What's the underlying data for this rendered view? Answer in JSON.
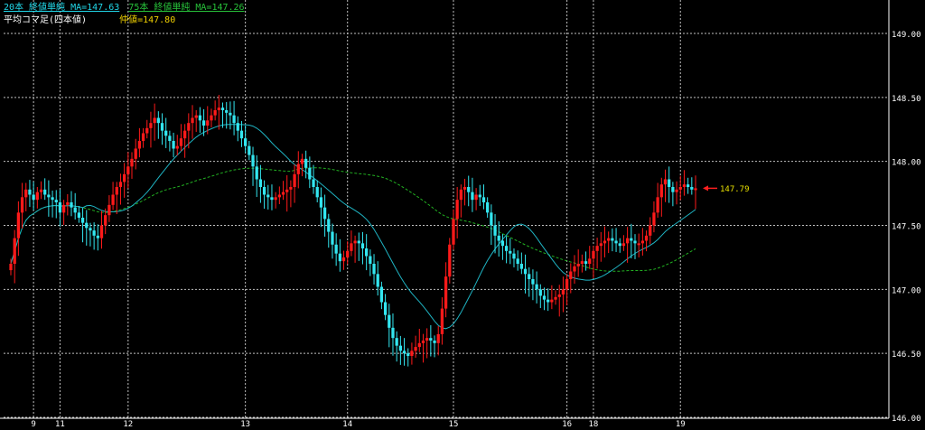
{
  "legend": {
    "ma20": "20本 終値単純 MA=147.63",
    "ma75": "75本 終値単純 MA=147.26",
    "candle_type": "平均コマ足(四本値)",
    "mid_price": "仲値=147.80"
  },
  "current_price_label": "147.79",
  "colors": {
    "background": "#000000",
    "grid": "#bfbfbf",
    "up": "#ff1a1a",
    "down": "#33e6f0",
    "ma20": "#1fb3c2",
    "ma75": "#22b022",
    "price_label": "#e8e000",
    "arrow": "#ff2020"
  },
  "chart_data": {
    "type": "candlestick",
    "y_ticks": [
      "149.00",
      "148.50",
      "148.00",
      "147.50",
      "147.00",
      "146.50",
      "146.00"
    ],
    "ylim": [
      146.0,
      149.2
    ],
    "x_ticks": [
      {
        "label": "9",
        "i": 6
      },
      {
        "label": "11",
        "i": 13
      },
      {
        "label": "12",
        "i": 31
      },
      {
        "label": "13",
        "i": 62
      },
      {
        "label": "14",
        "i": 89
      },
      {
        "label": "15",
        "i": 117
      },
      {
        "label": "16",
        "i": 147
      },
      {
        "label": "18",
        "i": 154
      },
      {
        "label": "19",
        "i": 177
      }
    ],
    "close": [
      147.2,
      147.4,
      147.6,
      147.72,
      147.78,
      147.74,
      147.7,
      147.76,
      147.78,
      147.74,
      147.72,
      147.7,
      147.68,
      147.6,
      147.66,
      147.68,
      147.64,
      147.6,
      147.56,
      147.52,
      147.48,
      147.46,
      147.42,
      147.4,
      147.5,
      147.58,
      147.66,
      147.74,
      147.8,
      147.84,
      147.9,
      147.96,
      148.02,
      148.1,
      148.16,
      148.22,
      148.26,
      148.3,
      148.34,
      148.3,
      148.24,
      148.2,
      148.16,
      148.1,
      148.12,
      148.18,
      148.24,
      148.3,
      148.34,
      148.36,
      148.32,
      148.28,
      148.32,
      148.36,
      148.4,
      148.42,
      148.4,
      148.38,
      148.36,
      148.3,
      148.24,
      148.18,
      148.12,
      148.05,
      147.96,
      147.86,
      147.8,
      147.74,
      147.72,
      147.7,
      147.72,
      147.74,
      147.76,
      147.78,
      147.8,
      147.9,
      147.98,
      148.02,
      147.95,
      147.86,
      147.8,
      147.72,
      147.64,
      147.55,
      147.45,
      147.35,
      147.28,
      147.22,
      147.25,
      147.3,
      147.36,
      147.38,
      147.36,
      147.32,
      147.26,
      147.2,
      147.12,
      147.02,
      146.9,
      146.8,
      146.7,
      146.62,
      146.56,
      146.52,
      146.5,
      146.48,
      146.52,
      146.55,
      146.58,
      146.6,
      146.62,
      146.6,
      146.58,
      146.65,
      146.85,
      147.1,
      147.35,
      147.55,
      147.7,
      147.78,
      147.8,
      147.76,
      147.7,
      147.74,
      147.72,
      147.68,
      147.6,
      147.5,
      147.42,
      147.38,
      147.34,
      147.3,
      147.28,
      147.24,
      147.2,
      147.16,
      147.12,
      147.08,
      147.04,
      147.0,
      146.95,
      146.92,
      146.9,
      146.92,
      146.94,
      146.96,
      147.0,
      147.08,
      147.14,
      147.18,
      147.2,
      147.22,
      147.2,
      147.24,
      147.3,
      147.34,
      147.36,
      147.38,
      147.4,
      147.38,
      147.36,
      147.34,
      147.36,
      147.4,
      147.38,
      147.36,
      147.36,
      147.38,
      147.42,
      147.5,
      147.6,
      147.72,
      147.82,
      147.86,
      147.8,
      147.76,
      147.78,
      147.8,
      147.82,
      147.8,
      147.78,
      147.79
    ]
  }
}
